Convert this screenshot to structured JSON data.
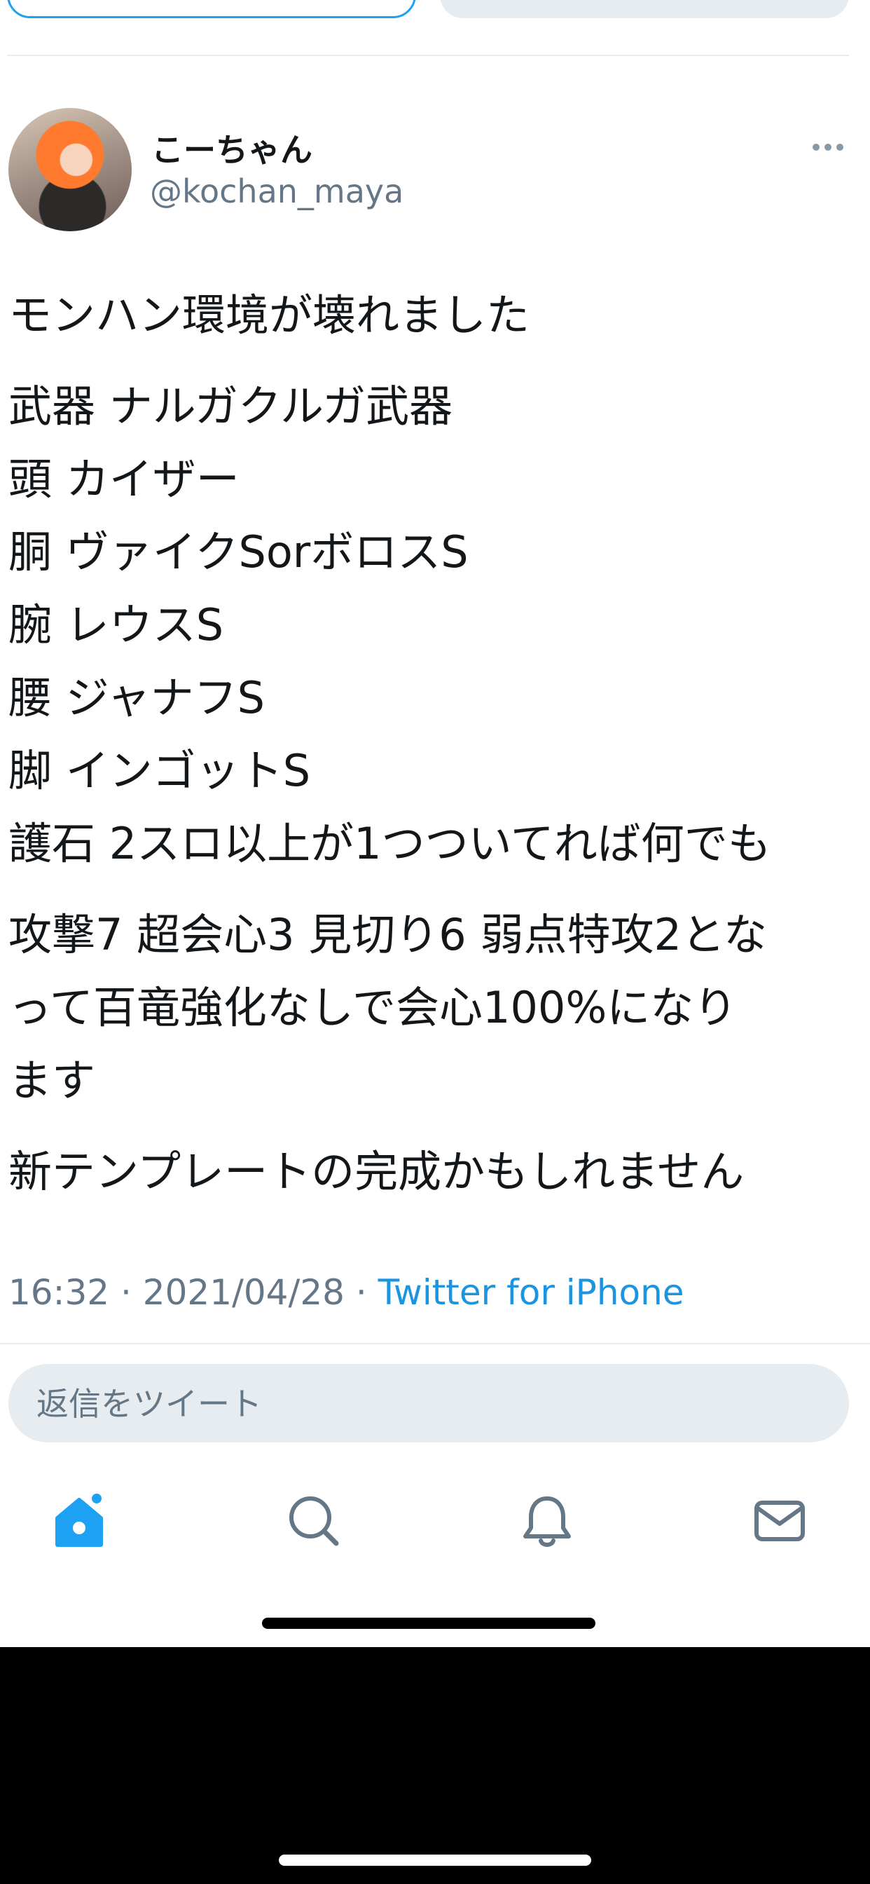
{
  "user": {
    "display_name": "こーちゃん",
    "handle": "@kochan_maya"
  },
  "tweet": {
    "paragraphs": [
      "モンハン環境が壊れました",
      "武器 ナルガクルガ武器\n頭 カイザー\n胴 ヴァイクSorボロスS\n腕 レウスS\n腰 ジャナフS\n脚 インゴットS\n護石 2スロ以上が1つついてれば何でも",
      "攻撃7 超会心3 見切り6 弱点特攻2とな\nって百竜強化なしで会心100%になり\nます",
      "新テンプレートの完成かもしれません"
    ],
    "time": "16:32",
    "separator": " · ",
    "date": "2021/04/28",
    "source": "Twitter for iPhone"
  },
  "reply": {
    "placeholder": "返信をツイート"
  },
  "tabbar": {
    "icons": [
      "home-icon",
      "search-icon",
      "notifications-icon",
      "messages-icon"
    ]
  },
  "colors": {
    "accent": "#1da1f2",
    "link": "#1b95e0",
    "secondary_text": "#657786",
    "divider": "#e6ecf0"
  }
}
